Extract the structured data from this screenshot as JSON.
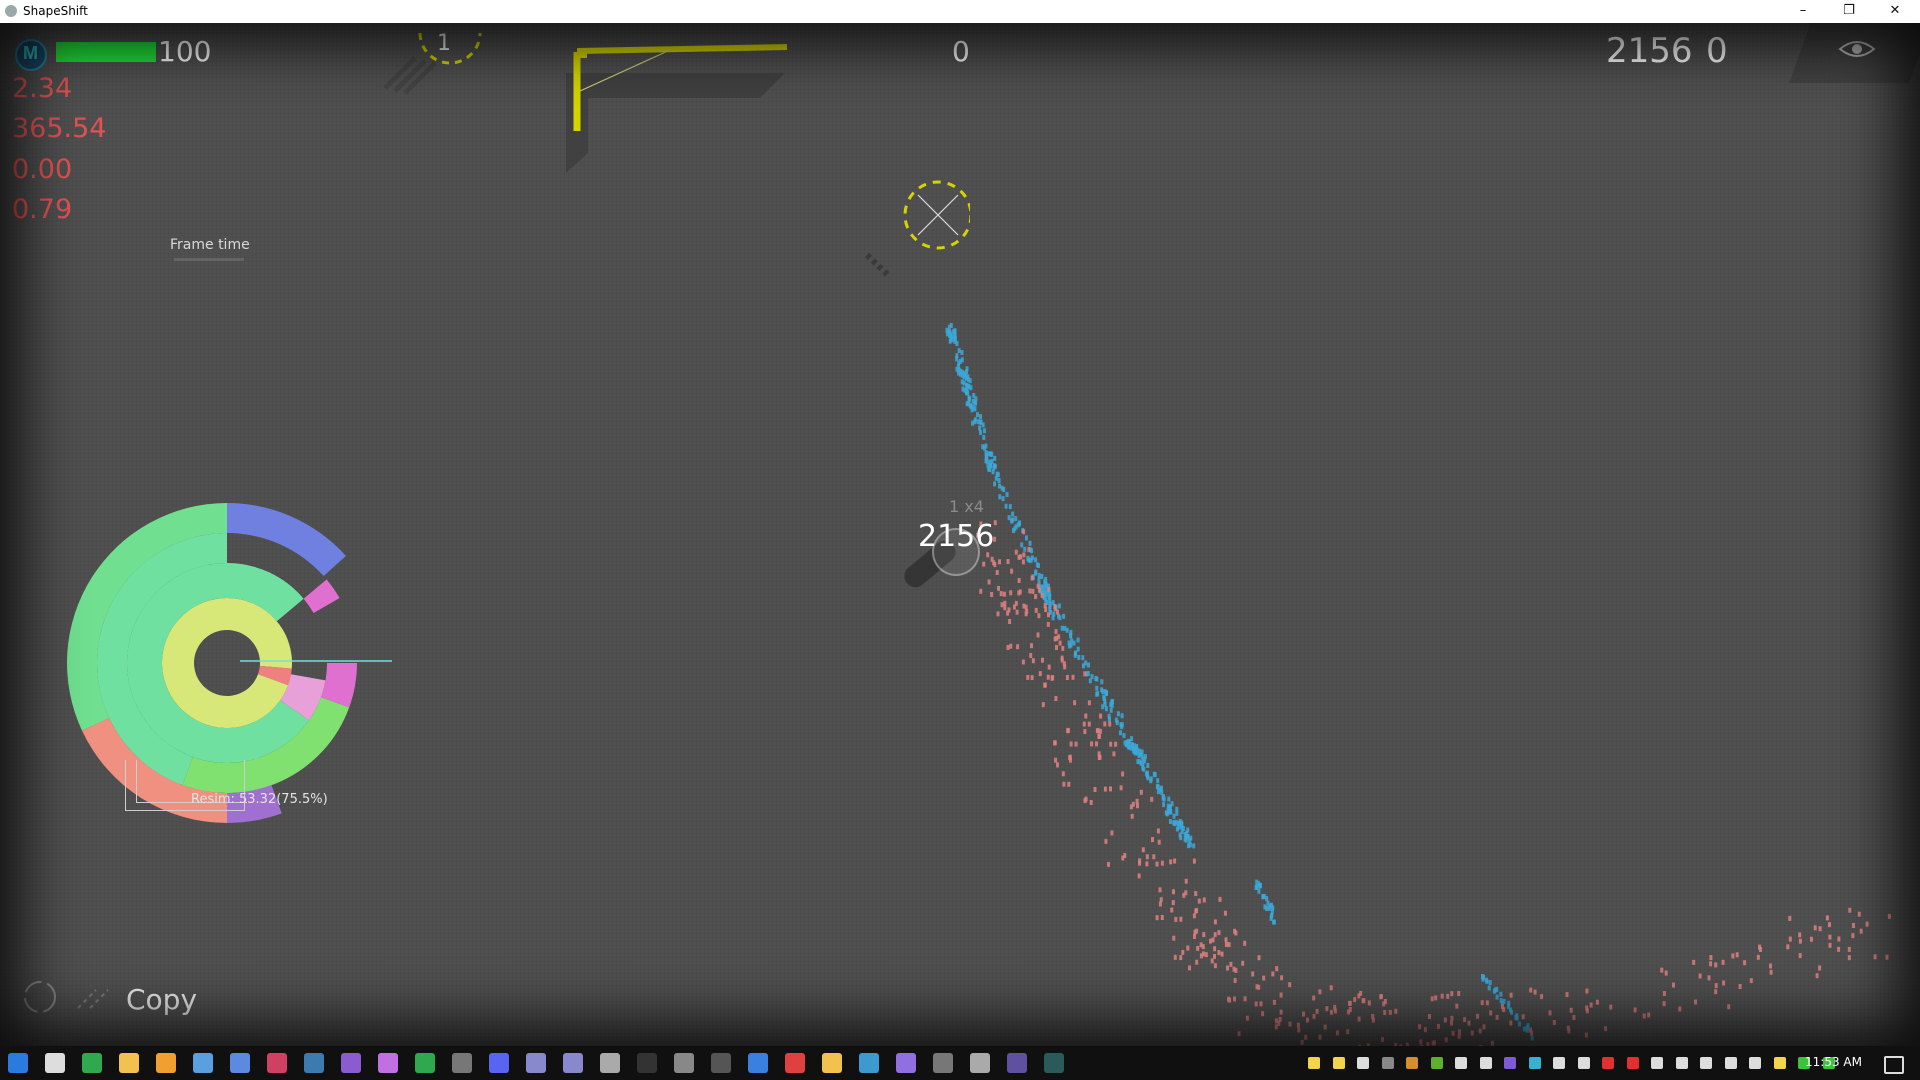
{
  "window": {
    "title": "ShapeShift",
    "controls": {
      "minimize": "–",
      "restore": "❐",
      "close": "✕"
    }
  },
  "hud": {
    "player_initial": "M",
    "health": 100,
    "health_value": "100",
    "stats": [
      "2.34",
      "365.54",
      "0.00",
      "0.79"
    ],
    "frame_time_label": "Frame time",
    "wave_number": "1",
    "center_score": "0",
    "score": "2156",
    "score_secondary": "0",
    "player_score": "2156",
    "multiplier": "1 x4",
    "pie_label": "Resim: 53.32(75.5%)",
    "ability_label": "Copy",
    "eye_icon": "eye-icon"
  },
  "colors": {
    "health_bar": "#22e03a",
    "stat_text": "#e25252",
    "stream_blue": "#3ca8d8",
    "stream_red": "#e08080",
    "yellow": "#d4d400",
    "background": "#505050"
  },
  "taskbar": {
    "time": "11:53 AM",
    "apps": [
      "windows-icon",
      "task-view-icon",
      "chrome-icon",
      "file-explorer-icon",
      "media-icon",
      "notepad-icon",
      "editor-icon",
      "paint-icon",
      "steam-icon",
      "visual-studio-icon",
      "vs-icon",
      "excel-icon",
      "terminal-icon",
      "discord-icon",
      "app-icon",
      "app-icon",
      "settings-icon",
      "terminal-icon",
      "obs-icon",
      "unity-icon",
      "git-icon",
      "git-icon",
      "notes-icon",
      "remote-icon",
      "vs-icon",
      "terminal-icon",
      "record-icon",
      "terminal-icon",
      "shapeshift-icon"
    ],
    "tray": [
      "folder-icon",
      "folder-icon",
      "db-icon",
      "app-icon",
      "app-icon",
      "nvidia-icon",
      "network-icon",
      "usb-icon",
      "vs-icon",
      "battery-icon",
      "chart-icon",
      "volume-icon",
      "antivirus-icon",
      "app-icon",
      "onenote-icon",
      "app-icon",
      "display-icon",
      "app-icon",
      "shield-icon",
      "star-icon",
      "app-icon",
      "app-icon",
      "notification-icon"
    ]
  }
}
